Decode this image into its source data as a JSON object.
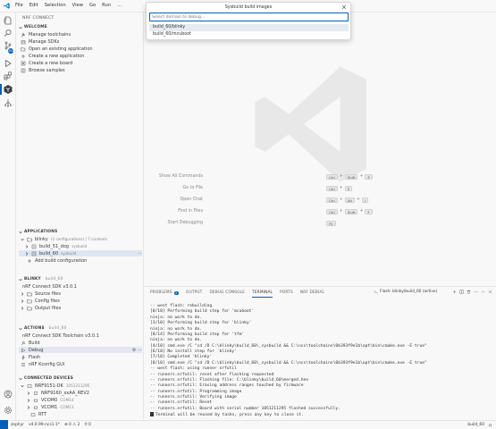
{
  "menu": [
    "File",
    "Edit",
    "Selection",
    "View",
    "Go",
    "Run",
    "…"
  ],
  "activity_badge": "192",
  "sidebar": {
    "title": "NRF CONNECT",
    "welcome": {
      "heading": "WELCOME",
      "items": [
        "Manage toolchains",
        "Manage SDKs",
        "Open an existing application",
        "Create a new application",
        "Create a new board",
        "Browse samples"
      ]
    },
    "applications": {
      "heading": "APPLICATIONS",
      "app_name": "blinky",
      "app_info": "(2 configurations) | 7 contexts",
      "builds": [
        {
          "name": "build_51_dog",
          "tag": "sysbuild"
        },
        {
          "name": "build_60",
          "tag": "sysbuild"
        }
      ],
      "add_label": "Add build configuration"
    },
    "blinky": {
      "heading": "BLINKY",
      "sub": "build_60",
      "items": [
        "nRF Connect SDK v3.0.1",
        "Source files",
        "Config files",
        "Output files"
      ]
    },
    "actions": {
      "heading": "ACTIONS",
      "sub": "build_60",
      "toolchain": "nRF Connect SDK Toolchain v3.0.1",
      "items": [
        "Build",
        "Debug",
        "Flash",
        "nRF Kconfig GUI"
      ]
    },
    "devices": {
      "heading": "CONNECTED DEVICES",
      "device": "NRF9151-DK",
      "serial": "1051211295",
      "children": [
        {
          "name": "NRF9160_xxAA_REV2",
          "tag": ""
        },
        {
          "name": "VCOM0",
          "tag": "COM14"
        },
        {
          "name": "VCOM1",
          "tag": "COM13"
        },
        {
          "name": "RTT",
          "tag": ""
        }
      ]
    }
  },
  "quickpick": {
    "title": "Sysbuild build images",
    "placeholder": "Select domain to debug...",
    "options": [
      "build_60/blinky",
      "build_60/mcuboot"
    ]
  },
  "shortcuts": [
    {
      "label": "Show All Commands",
      "keys": [
        "Ctrl",
        "+",
        "Shift",
        "+",
        "P"
      ]
    },
    {
      "label": "Go to File",
      "keys": [
        "Ctrl",
        "+",
        "P"
      ]
    },
    {
      "label": "Open Chat",
      "keys": [
        "Ctrl",
        "+",
        "Alt",
        "+",
        "I"
      ]
    },
    {
      "label": "Find in Files",
      "keys": [
        "Ctrl",
        "+",
        "Shift",
        "+",
        "F"
      ]
    },
    {
      "label": "Start Debugging",
      "keys": [
        "F5"
      ]
    }
  ],
  "panel": {
    "tabs": [
      "PROBLEMS",
      "OUTPUT",
      "DEBUG CONSOLE",
      "TERMINAL",
      "PORTS",
      "NRF DEBUG"
    ],
    "problems_count": "2",
    "terminal_name": "Flash: blinky/build_60 (active)",
    "terminal_lines": [
      "-- west flash: rebuilding",
      "[0/10] Performing build step for 'mcuboot'",
      "ninja: no work to do.",
      "[3/10] Performing build step for 'blinky'",
      "ninja: no work to do.",
      "[8/14] Performing build step for 'tfm'",
      "ninja: no work to do.",
      "[4/10] cmd.exe /C \"cd /D C:\\blinky\\build_60\\_sysbuild && C:\\ncs\\toolchains\\0b393f9e1b\\opt\\bin\\cmake.exe -E true\"",
      "[6/10] No install step for 'blinky'",
      "[7/10] Completed 'blinky'",
      "[8/10] cmd.exe /C \"cd /D C:\\blinky\\build_60\\_sysbuild && C:\\ncs\\toolchains\\0b393f9e1b\\opt\\bin\\cmake.exe -E true\"",
      "-- west flash: using runner nrfutil",
      "-- runners.nrfutil: reset after flashing requested",
      "-- runners.nrfutil: Flashing file: C:\\blinky\\build_60\\merged.hex",
      "-- runners.nrfutil: Erasing address ranges touched by firmware",
      "-- runners.nrfutil: Programming image",
      "-- runners.nrfutil: Verifying image",
      "-- runners.nrfutil: Reset",
      "-- runners.nrfutil: Board with serial number 1051211295 flashed successfully.",
      "Terminal will be reused by tasks, press any key to close it."
    ]
  },
  "statusbar": {
    "left": [
      "zephyr",
      "v4.0.99-ncs1-1*",
      "⊗ 0 ⚠ 2",
      "⚲ 0"
    ],
    "right": [
      "build_60"
    ]
  },
  "colors": {
    "accent": "#005fb8",
    "selected": "#dde7f3"
  }
}
